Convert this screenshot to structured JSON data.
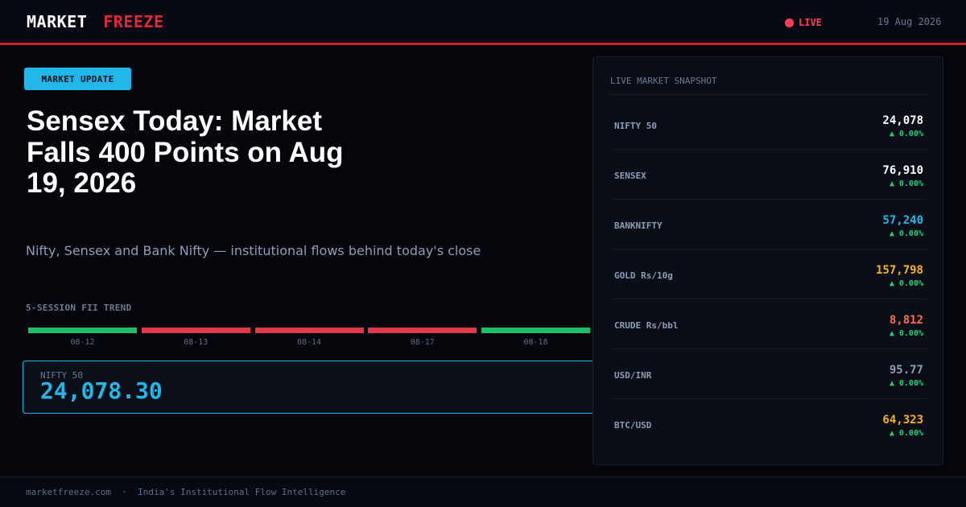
{
  "header": {
    "brand_part1": "MARKET",
    "brand_part2": "FREEZE",
    "live_label": "LIVE",
    "date": "19 Aug 2026"
  },
  "badge": "MARKET UPDATE",
  "headline": "Sensex Today: Market Falls 400 Points on Aug 19, 2026",
  "subheadline": "Nifty, Sensex and Bank Nifty — institutional flows behind today's close",
  "trend": {
    "title": "5-SESSION FII TREND",
    "sessions": [
      {
        "label": "08-12",
        "direction": "up"
      },
      {
        "label": "08-13",
        "direction": "down"
      },
      {
        "label": "08-14",
        "direction": "down"
      },
      {
        "label": "08-17",
        "direction": "down"
      },
      {
        "label": "08-18",
        "direction": "up"
      }
    ]
  },
  "nifty_box": {
    "label": "NIFTY 50",
    "value": "24,078.30"
  },
  "snapshot": {
    "title": "LIVE MARKET SNAPSHOT",
    "rows": [
      {
        "name": "NIFTY 50",
        "value": "24,078",
        "change": "▲ 0.00%",
        "color": "#ffffff"
      },
      {
        "name": "SENSEX",
        "value": "76,910",
        "change": "▲ 0.00%",
        "color": "#ffffff"
      },
      {
        "name": "BANKNIFTY",
        "value": "57,240",
        "change": "▲ 0.00%",
        "color": "#22b7e8"
      },
      {
        "name": "GOLD Rs/10g",
        "value": "157,798",
        "change": "▲ 0.00%",
        "color": "#f5b21c"
      },
      {
        "name": "CRUDE Rs/bbl",
        "value": "8,812",
        "change": "▲ 0.00%",
        "color": "#ff6b4a"
      },
      {
        "name": "USD/INR",
        "value": "95.77",
        "change": "▲ 0.00%",
        "color": "#8e9db5"
      },
      {
        "name": "BTC/USD",
        "value": "64,323",
        "change": "▲ 0.00%",
        "color": "#f5b21c"
      }
    ]
  },
  "footer": {
    "site": "marketfreeze.com",
    "separator": "·",
    "tagline": "India's Institutional Flow Intelligence"
  },
  "colors": {
    "accent_red": "#d01d2a",
    "accent_blue": "#22b7e8",
    "up": "#1fbf6a",
    "down": "#e0384b"
  }
}
